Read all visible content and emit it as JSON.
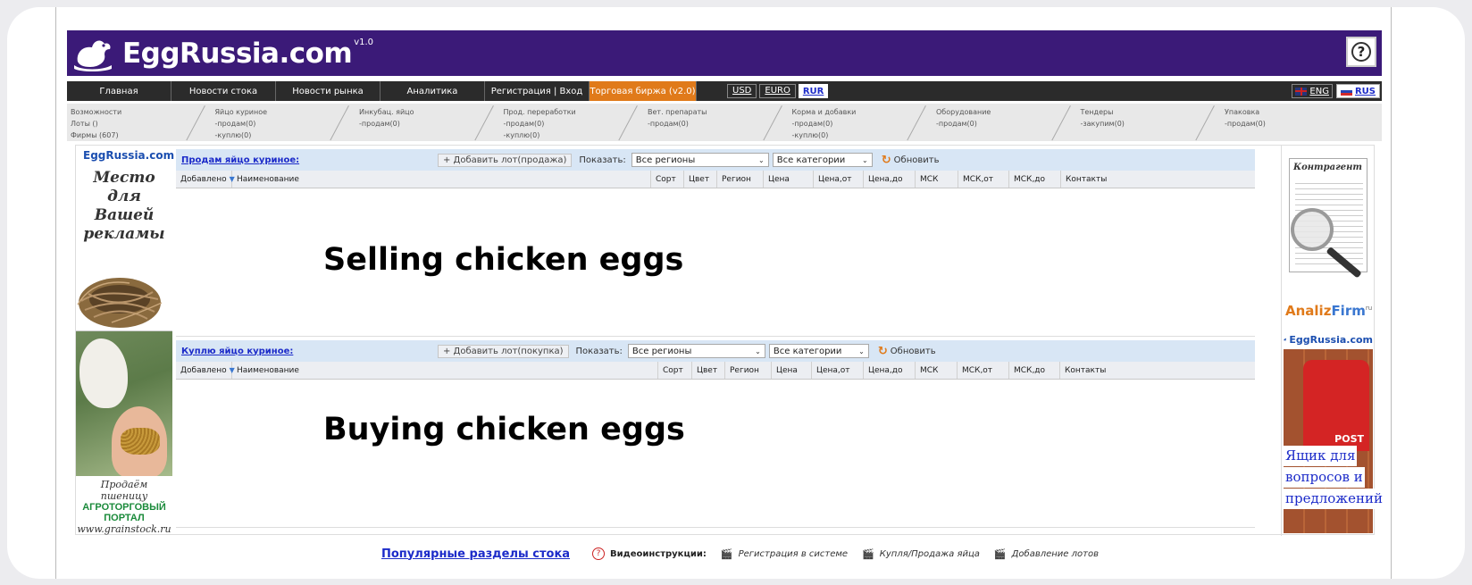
{
  "header": {
    "logo_text": "EggRussia.com",
    "version": "v1.0",
    "help_symbol": "?"
  },
  "nav": {
    "items": [
      "Главная",
      "Новости стока",
      "Новости рынка",
      "Аналитика",
      "Регистрация | Вход",
      "Торговая биржа (v2.0)"
    ],
    "currencies": [
      "USD",
      "EURO",
      "RUR"
    ],
    "selected_currency": "RUR",
    "languages": [
      "ENG",
      "RUS"
    ]
  },
  "subnav": [
    [
      "Возможности",
      "Лоты ()",
      "Фирмы (607)"
    ],
    [
      "Яйцо куриное",
      "-продам(0)",
      "-куплю(0)"
    ],
    [
      "Инкубац. яйцо",
      "-продам(0)"
    ],
    [
      "Прод. переработки",
      "-продам(0)",
      "-куплю(0)"
    ],
    [
      "Вет. препараты",
      "-продам(0)"
    ],
    [
      "Корма и добавки",
      "-продам(0)",
      "-куплю(0)"
    ],
    [
      "Оборудование",
      "-продам(0)"
    ],
    [
      "Тендеры",
      "-закупим(0)"
    ],
    [
      "Упаковка",
      "-продам(0)"
    ]
  ],
  "left_ad": {
    "logo": "EggRussia.com",
    "text": [
      "Место для",
      "Вашей",
      "рекламы"
    ],
    "grain_lines": [
      "Продаём пшеницу",
      "АГРОТОРГОВЫЙ ПОРТАЛ",
      "www.grainstock.ru"
    ]
  },
  "sell": {
    "title": "Продам яйцо куриное:",
    "add_button": "+ Добавить лот(продажа)",
    "show_label": "Показать:",
    "region": "Все регионы",
    "category": "Все категории",
    "refresh": "Обновить",
    "columns": [
      "Добавлено",
      "Наименование",
      "Сорт",
      "Цвет",
      "Регион",
      "Цена",
      "Цена,от",
      "Цена,до",
      "МСК",
      "МСК,от",
      "МСК,до",
      "Контакты"
    ],
    "overlay": "Selling chicken eggs"
  },
  "buy": {
    "title": "Куплю яйцо куриное:",
    "add_button": "+ Добавить лот(покупка)",
    "show_label": "Показать:",
    "region": "Все регионы",
    "category": "Все категории",
    "refresh": "Обновить",
    "columns": [
      "Добавлено",
      "Наименование",
      "Сорт",
      "Цвет",
      "Регион",
      "Цена",
      "Цена,от",
      "Цена,до",
      "МСК",
      "МСК,от",
      "МСК,до",
      "Контакты"
    ],
    "overlay": "Buying chicken eggs"
  },
  "right_ad": {
    "doc_title": "Контрагент",
    "analiz_part1": "Analiz",
    "analiz_part2": "Firm",
    "analiz_sup": "ru",
    "post_logo": "EggRussia.com",
    "post_word": "POST",
    "post_lines": [
      "Ящик для",
      "вопросов и",
      "предложений"
    ]
  },
  "footer": {
    "popular": "Популярные разделы стока",
    "video_label": "Видеоинструкции:",
    "links": [
      "Регистрация в системе",
      "Купля/Продажа яйца",
      "Добавление лотов"
    ]
  }
}
